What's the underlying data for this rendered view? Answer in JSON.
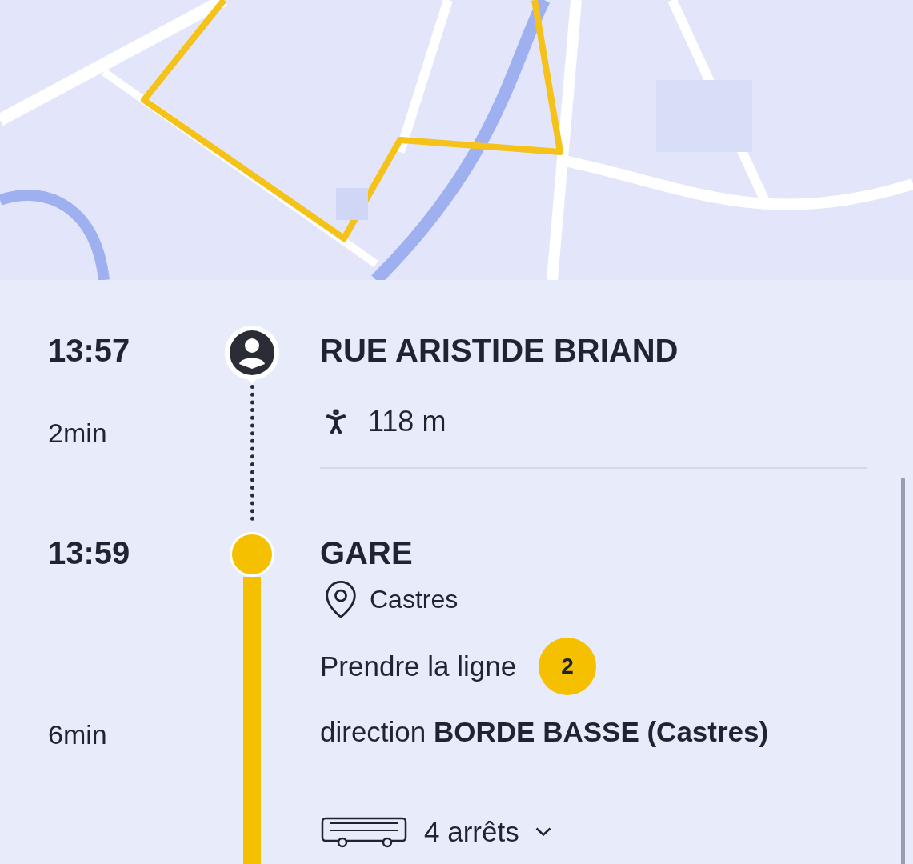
{
  "steps": [
    {
      "kind": "walk",
      "time": "13:57",
      "duration": "2min",
      "place": "RUE ARISTIDE BRIAND",
      "distance": "118 m"
    },
    {
      "kind": "bus",
      "time": "13:59",
      "duration": "6min",
      "place": "GARE",
      "city": "Castres",
      "instruction": "Prendre la ligne",
      "line": "2",
      "direction": "direction **BORDE BASSE (Castres)**",
      "stops": "4 arrêts",
      "expanded": false
    }
  ]
}
